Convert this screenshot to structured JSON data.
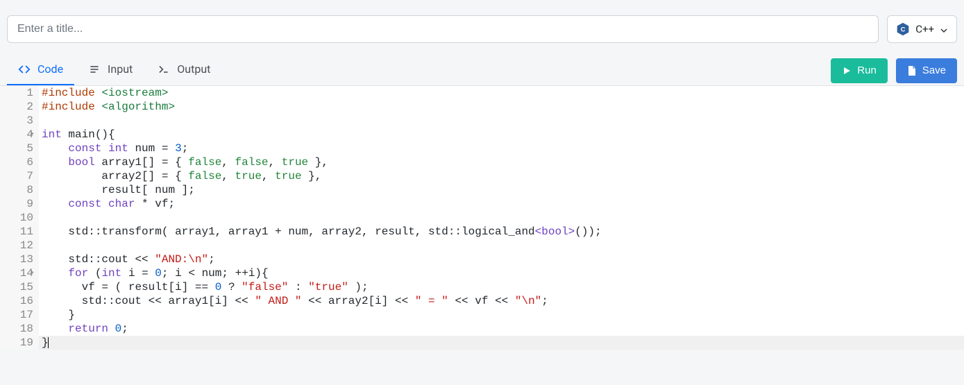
{
  "title_placeholder": "Enter a title...",
  "title_value": "",
  "language": {
    "label": "C++",
    "icon": "cpp-hex-icon"
  },
  "tabs": [
    {
      "id": "code",
      "label": "Code",
      "icon": "code-icon",
      "active": true
    },
    {
      "id": "input",
      "label": "Input",
      "icon": "input-lines-icon",
      "active": false
    },
    {
      "id": "output",
      "label": "Output",
      "icon": "terminal-prompt-icon",
      "active": false
    }
  ],
  "buttons": {
    "run": "Run",
    "save": "Save"
  },
  "code_lines": [
    {
      "n": 1,
      "fold": "",
      "tokens": [
        [
          "pp",
          "#include"
        ],
        [
          "plain",
          " "
        ],
        [
          "sys",
          "<iostream>"
        ]
      ]
    },
    {
      "n": 2,
      "fold": "",
      "tokens": [
        [
          "pp",
          "#include"
        ],
        [
          "plain",
          " "
        ],
        [
          "sys",
          "<algorithm>"
        ]
      ]
    },
    {
      "n": 3,
      "fold": "",
      "tokens": []
    },
    {
      "n": 4,
      "fold": "▸",
      "tokens": [
        [
          "kw",
          "int"
        ],
        [
          "plain",
          " "
        ],
        [
          "id",
          "main"
        ],
        [
          "op",
          "()"
        ],
        [
          "op",
          "{"
        ]
      ]
    },
    {
      "n": 5,
      "fold": "",
      "tokens": [
        [
          "plain",
          "    "
        ],
        [
          "kw",
          "const"
        ],
        [
          "plain",
          " "
        ],
        [
          "kw",
          "int"
        ],
        [
          "plain",
          " "
        ],
        [
          "id",
          "num"
        ],
        [
          "plain",
          " "
        ],
        [
          "op",
          "="
        ],
        [
          "plain",
          " "
        ],
        [
          "num",
          "3"
        ],
        [
          "op",
          ";"
        ]
      ]
    },
    {
      "n": 6,
      "fold": "",
      "tokens": [
        [
          "plain",
          "    "
        ],
        [
          "kw",
          "bool"
        ],
        [
          "plain",
          " "
        ],
        [
          "id",
          "array1"
        ],
        [
          "op",
          "[]"
        ],
        [
          "plain",
          " "
        ],
        [
          "op",
          "="
        ],
        [
          "plain",
          " "
        ],
        [
          "op",
          "{"
        ],
        [
          "plain",
          " "
        ],
        [
          "bool",
          "false"
        ],
        [
          "op",
          ","
        ],
        [
          "plain",
          " "
        ],
        [
          "bool",
          "false"
        ],
        [
          "op",
          ","
        ],
        [
          "plain",
          " "
        ],
        [
          "bool",
          "true"
        ],
        [
          "plain",
          " "
        ],
        [
          "op",
          "}"
        ],
        [
          "op",
          ","
        ]
      ]
    },
    {
      "n": 7,
      "fold": "",
      "tokens": [
        [
          "plain",
          "         "
        ],
        [
          "id",
          "array2"
        ],
        [
          "op",
          "[]"
        ],
        [
          "plain",
          " "
        ],
        [
          "op",
          "="
        ],
        [
          "plain",
          " "
        ],
        [
          "op",
          "{"
        ],
        [
          "plain",
          " "
        ],
        [
          "bool",
          "false"
        ],
        [
          "op",
          ","
        ],
        [
          "plain",
          " "
        ],
        [
          "bool",
          "true"
        ],
        [
          "op",
          ","
        ],
        [
          "plain",
          " "
        ],
        [
          "bool",
          "true"
        ],
        [
          "plain",
          " "
        ],
        [
          "op",
          "}"
        ],
        [
          "op",
          ","
        ]
      ]
    },
    {
      "n": 8,
      "fold": "",
      "tokens": [
        [
          "plain",
          "         "
        ],
        [
          "id",
          "result"
        ],
        [
          "op",
          "["
        ],
        [
          "plain",
          " "
        ],
        [
          "id",
          "num"
        ],
        [
          "plain",
          " "
        ],
        [
          "op",
          "]"
        ],
        [
          "op",
          ";"
        ]
      ]
    },
    {
      "n": 9,
      "fold": "",
      "tokens": [
        [
          "plain",
          "    "
        ],
        [
          "kw",
          "const"
        ],
        [
          "plain",
          " "
        ],
        [
          "kw",
          "char"
        ],
        [
          "plain",
          " "
        ],
        [
          "op",
          "*"
        ],
        [
          "plain",
          " "
        ],
        [
          "id",
          "vf"
        ],
        [
          "op",
          ";"
        ]
      ]
    },
    {
      "n": 10,
      "fold": "",
      "tokens": []
    },
    {
      "n": 11,
      "fold": "",
      "tokens": [
        [
          "plain",
          "    "
        ],
        [
          "ns",
          "std"
        ],
        [
          "op",
          "::"
        ],
        [
          "id",
          "transform"
        ],
        [
          "op",
          "("
        ],
        [
          "plain",
          " "
        ],
        [
          "id",
          "array1"
        ],
        [
          "op",
          ","
        ],
        [
          "plain",
          " "
        ],
        [
          "id",
          "array1"
        ],
        [
          "plain",
          " "
        ],
        [
          "op",
          "+"
        ],
        [
          "plain",
          " "
        ],
        [
          "id",
          "num"
        ],
        [
          "op",
          ","
        ],
        [
          "plain",
          " "
        ],
        [
          "id",
          "array2"
        ],
        [
          "op",
          ","
        ],
        [
          "plain",
          " "
        ],
        [
          "id",
          "result"
        ],
        [
          "op",
          ","
        ],
        [
          "plain",
          " "
        ],
        [
          "ns",
          "std"
        ],
        [
          "op",
          "::"
        ],
        [
          "id",
          "logical_and"
        ],
        [
          "lt",
          "<"
        ],
        [
          "kw",
          "bool"
        ],
        [
          "lt",
          ">"
        ],
        [
          "op",
          "()"
        ],
        [
          "op",
          ")"
        ],
        [
          "op",
          ";"
        ]
      ]
    },
    {
      "n": 12,
      "fold": "",
      "tokens": []
    },
    {
      "n": 13,
      "fold": "",
      "tokens": [
        [
          "plain",
          "    "
        ],
        [
          "ns",
          "std"
        ],
        [
          "op",
          "::"
        ],
        [
          "id",
          "cout"
        ],
        [
          "plain",
          " "
        ],
        [
          "op",
          "<<"
        ],
        [
          "plain",
          " "
        ],
        [
          "str",
          "\"AND:\\n\""
        ],
        [
          "op",
          ";"
        ]
      ]
    },
    {
      "n": 14,
      "fold": "▸",
      "tokens": [
        [
          "plain",
          "    "
        ],
        [
          "kw",
          "for"
        ],
        [
          "plain",
          " "
        ],
        [
          "op",
          "("
        ],
        [
          "kw",
          "int"
        ],
        [
          "plain",
          " "
        ],
        [
          "id",
          "i"
        ],
        [
          "plain",
          " "
        ],
        [
          "op",
          "="
        ],
        [
          "plain",
          " "
        ],
        [
          "num",
          "0"
        ],
        [
          "op",
          ";"
        ],
        [
          "plain",
          " "
        ],
        [
          "id",
          "i"
        ],
        [
          "plain",
          " "
        ],
        [
          "op",
          "<"
        ],
        [
          "plain",
          " "
        ],
        [
          "id",
          "num"
        ],
        [
          "op",
          ";"
        ],
        [
          "plain",
          " "
        ],
        [
          "op",
          "++"
        ],
        [
          "id",
          "i"
        ],
        [
          "op",
          ")"
        ],
        [
          "op",
          "{"
        ]
      ]
    },
    {
      "n": 15,
      "fold": "",
      "tokens": [
        [
          "plain",
          "      "
        ],
        [
          "id",
          "vf"
        ],
        [
          "plain",
          " "
        ],
        [
          "op",
          "="
        ],
        [
          "plain",
          " "
        ],
        [
          "op",
          "("
        ],
        [
          "plain",
          " "
        ],
        [
          "id",
          "result"
        ],
        [
          "op",
          "["
        ],
        [
          "id",
          "i"
        ],
        [
          "op",
          "]"
        ],
        [
          "plain",
          " "
        ],
        [
          "op",
          "=="
        ],
        [
          "plain",
          " "
        ],
        [
          "num",
          "0"
        ],
        [
          "plain",
          " "
        ],
        [
          "op",
          "?"
        ],
        [
          "plain",
          " "
        ],
        [
          "str",
          "\"false\""
        ],
        [
          "plain",
          " "
        ],
        [
          "op",
          ":"
        ],
        [
          "plain",
          " "
        ],
        [
          "str",
          "\"true\""
        ],
        [
          "plain",
          " "
        ],
        [
          "op",
          ")"
        ],
        [
          "op",
          ";"
        ]
      ]
    },
    {
      "n": 16,
      "fold": "",
      "tokens": [
        [
          "plain",
          "      "
        ],
        [
          "ns",
          "std"
        ],
        [
          "op",
          "::"
        ],
        [
          "id",
          "cout"
        ],
        [
          "plain",
          " "
        ],
        [
          "op",
          "<<"
        ],
        [
          "plain",
          " "
        ],
        [
          "id",
          "array1"
        ],
        [
          "op",
          "["
        ],
        [
          "id",
          "i"
        ],
        [
          "op",
          "]"
        ],
        [
          "plain",
          " "
        ],
        [
          "op",
          "<<"
        ],
        [
          "plain",
          " "
        ],
        [
          "str",
          "\" AND \""
        ],
        [
          "plain",
          " "
        ],
        [
          "op",
          "<<"
        ],
        [
          "plain",
          " "
        ],
        [
          "id",
          "array2"
        ],
        [
          "op",
          "["
        ],
        [
          "id",
          "i"
        ],
        [
          "op",
          "]"
        ],
        [
          "plain",
          " "
        ],
        [
          "op",
          "<<"
        ],
        [
          "plain",
          " "
        ],
        [
          "str",
          "\" = \""
        ],
        [
          "plain",
          " "
        ],
        [
          "op",
          "<<"
        ],
        [
          "plain",
          " "
        ],
        [
          "id",
          "vf"
        ],
        [
          "plain",
          " "
        ],
        [
          "op",
          "<<"
        ],
        [
          "plain",
          " "
        ],
        [
          "str",
          "\"\\n\""
        ],
        [
          "op",
          ";"
        ]
      ]
    },
    {
      "n": 17,
      "fold": "",
      "tokens": [
        [
          "plain",
          "    "
        ],
        [
          "op",
          "}"
        ]
      ]
    },
    {
      "n": 18,
      "fold": "",
      "tokens": [
        [
          "plain",
          "    "
        ],
        [
          "kw",
          "return"
        ],
        [
          "plain",
          " "
        ],
        [
          "num",
          "0"
        ],
        [
          "op",
          ";"
        ]
      ]
    },
    {
      "n": 19,
      "fold": "",
      "active": true,
      "tokens": [
        [
          "op",
          "}"
        ]
      ]
    }
  ]
}
